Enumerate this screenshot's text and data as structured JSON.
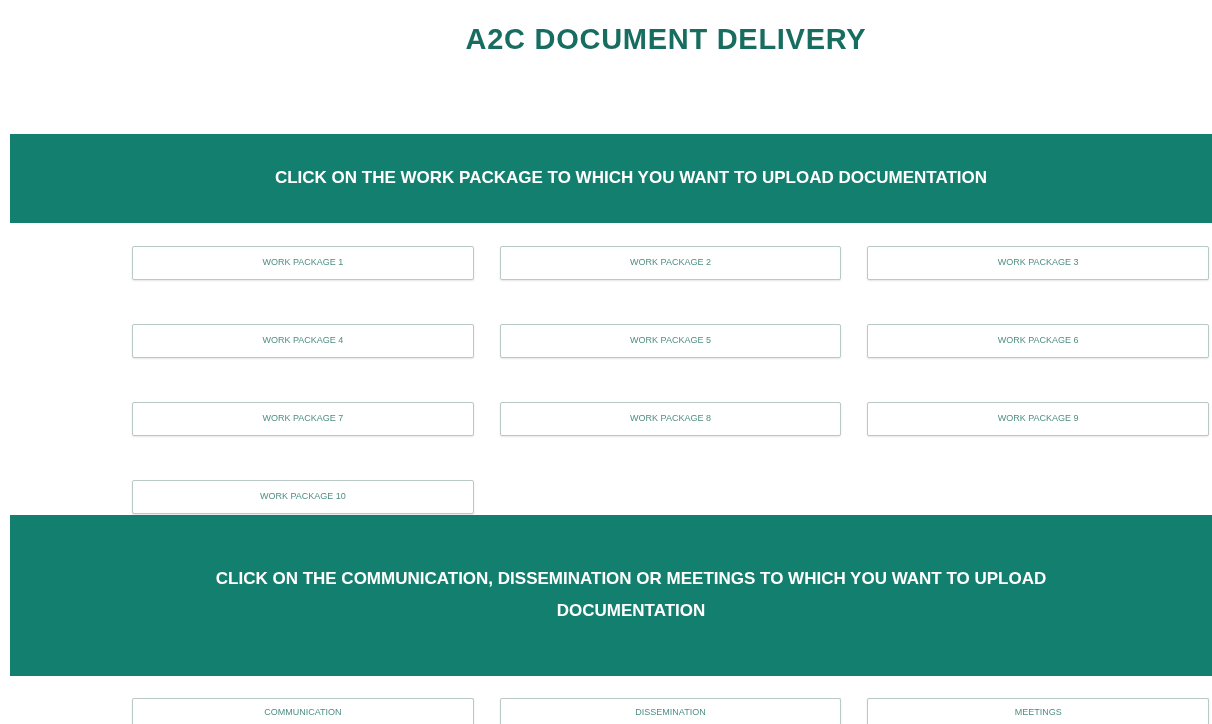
{
  "title": "A2C DOCUMENT DELIVERY",
  "sections": [
    {
      "heading": "CLICK ON THE WORK PACKAGE TO WHICH YOU WANT TO UPLOAD DOCUMENTATION",
      "buttons": [
        "WORK PACKAGE 1",
        "WORK PACKAGE 2",
        "WORK PACKAGE 3",
        "WORK PACKAGE 4",
        "WORK PACKAGE 5",
        "WORK PACKAGE 6",
        "WORK PACKAGE 7",
        "WORK PACKAGE 8",
        "WORK PACKAGE 9",
        "WORK PACKAGE 10"
      ]
    },
    {
      "heading": "CLICK ON THE COMMUNICATION, DISSEMINATION OR MEETINGS TO WHICH YOU WANT TO UPLOAD DOCUMENTATION",
      "buttons": [
        "COMMUNICATION",
        "DISSEMINATION",
        "MEETINGS"
      ]
    }
  ]
}
